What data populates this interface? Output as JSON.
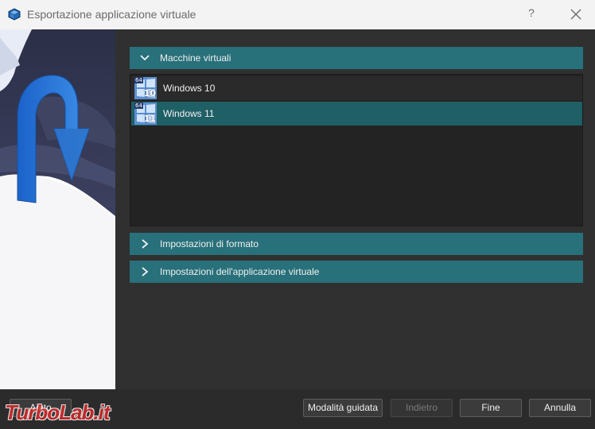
{
  "window": {
    "title": "Esportazione applicazione virtuale",
    "help_label": "?",
    "icons": {
      "app": "virtualbox-icon",
      "close": "close-icon"
    }
  },
  "sections": {
    "vms_header": "Macchine virtuali",
    "format_header": "Impostazioni di formato",
    "appliance_header": "Impostazioni dell'applicazione virtuale"
  },
  "vm_list": [
    {
      "name": "Windows 10",
      "badge": "64",
      "version": "10",
      "selected": false
    },
    {
      "name": "Windows 11",
      "badge": "64",
      "version": "11",
      "selected": true
    }
  ],
  "footer": {
    "help_label": "Aiuto",
    "guided_label": "Modalità guidata",
    "back_label": "Indietro",
    "finish_label": "Fine",
    "cancel_label": "Annulla"
  },
  "watermark": {
    "text_part1": "Turbo",
    "text_part2": "Lab.it"
  },
  "colors": {
    "section_header": "#28707a",
    "selected_row": "#1f5f66",
    "background": "#303030",
    "title_bar": "#f3f3f3",
    "watermark": "#d62828"
  }
}
